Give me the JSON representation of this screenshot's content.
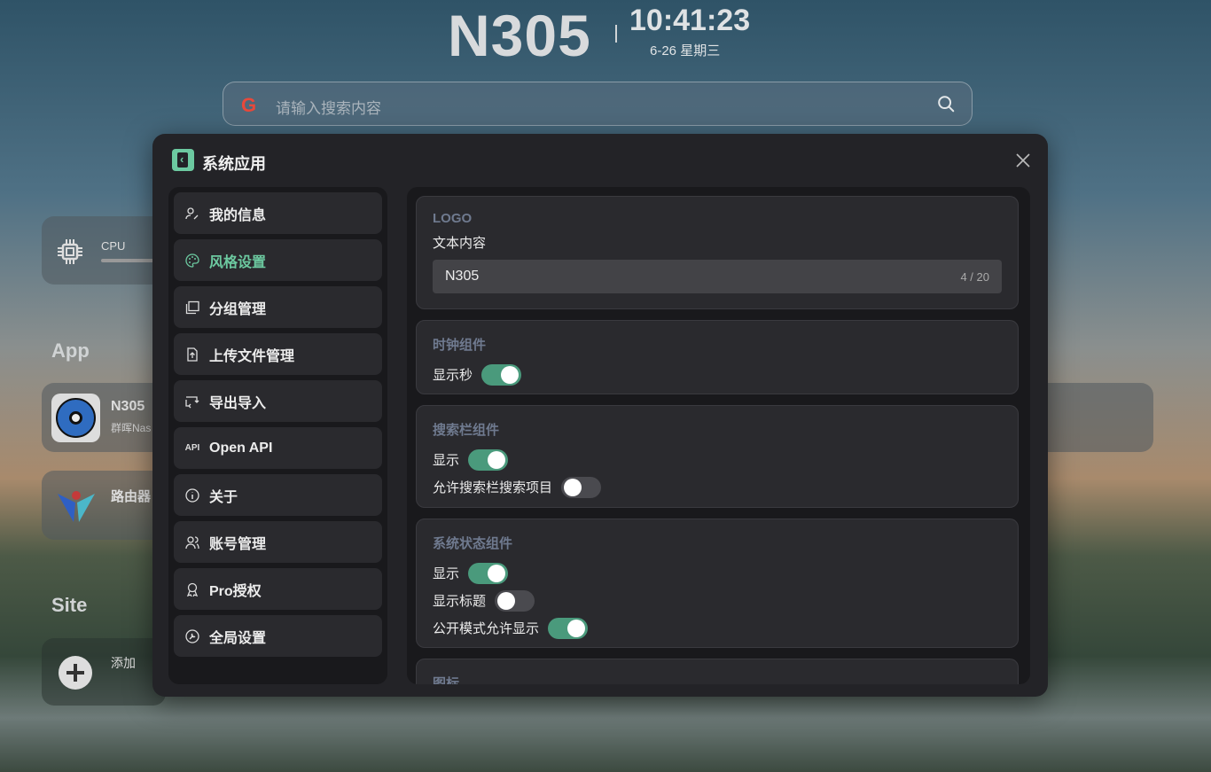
{
  "header": {
    "logo": "N305",
    "time": "10:41:23",
    "date": "6-26 星期三"
  },
  "search": {
    "placeholder": "请输入搜索内容",
    "engine_icon": "google-icon"
  },
  "background": {
    "cpu_label": "CPU",
    "app_heading": "App",
    "apps": [
      {
        "title": "N305",
        "subtitle": "群晖Nas"
      },
      {
        "title": "路由器"
      }
    ],
    "site_heading": "Site",
    "add_label": "添加"
  },
  "modal": {
    "title": "系统应用",
    "sidebar": [
      {
        "label": "我的信息",
        "icon": "user-edit-icon"
      },
      {
        "label": "风格设置",
        "icon": "palette-icon",
        "active": true
      },
      {
        "label": "分组管理",
        "icon": "layers-icon"
      },
      {
        "label": "上传文件管理",
        "icon": "file-upload-icon"
      },
      {
        "label": "导出导入",
        "icon": "transfer-icon"
      },
      {
        "label": "Open API",
        "icon": "api-icon"
      },
      {
        "label": "关于",
        "icon": "info-icon"
      },
      {
        "label": "账号管理",
        "icon": "users-icon"
      },
      {
        "label": "Pro授权",
        "icon": "award-icon"
      },
      {
        "label": "全局设置",
        "icon": "settings-icon"
      }
    ],
    "logo_card": {
      "title": "LOGO",
      "label": "文本内容",
      "value": "N305",
      "count": "4 / 20"
    },
    "clock_card": {
      "title": "时钟组件",
      "show_seconds": "显示秒",
      "show_seconds_on": true
    },
    "search_card": {
      "title": "搜索栏组件",
      "show": "显示",
      "show_on": true,
      "allow_search": "允许搜索栏搜索项目",
      "allow_search_on": false
    },
    "status_card": {
      "title": "系统状态组件",
      "show": "显示",
      "show_on": true,
      "show_title": "显示标题",
      "show_title_on": false,
      "public_show": "公开模式允许显示",
      "public_show_on": true
    },
    "icon_card": {
      "title": "图标"
    }
  },
  "colors": {
    "accent": "#6cc9a0",
    "toggle_on": "#4a9a7c"
  }
}
